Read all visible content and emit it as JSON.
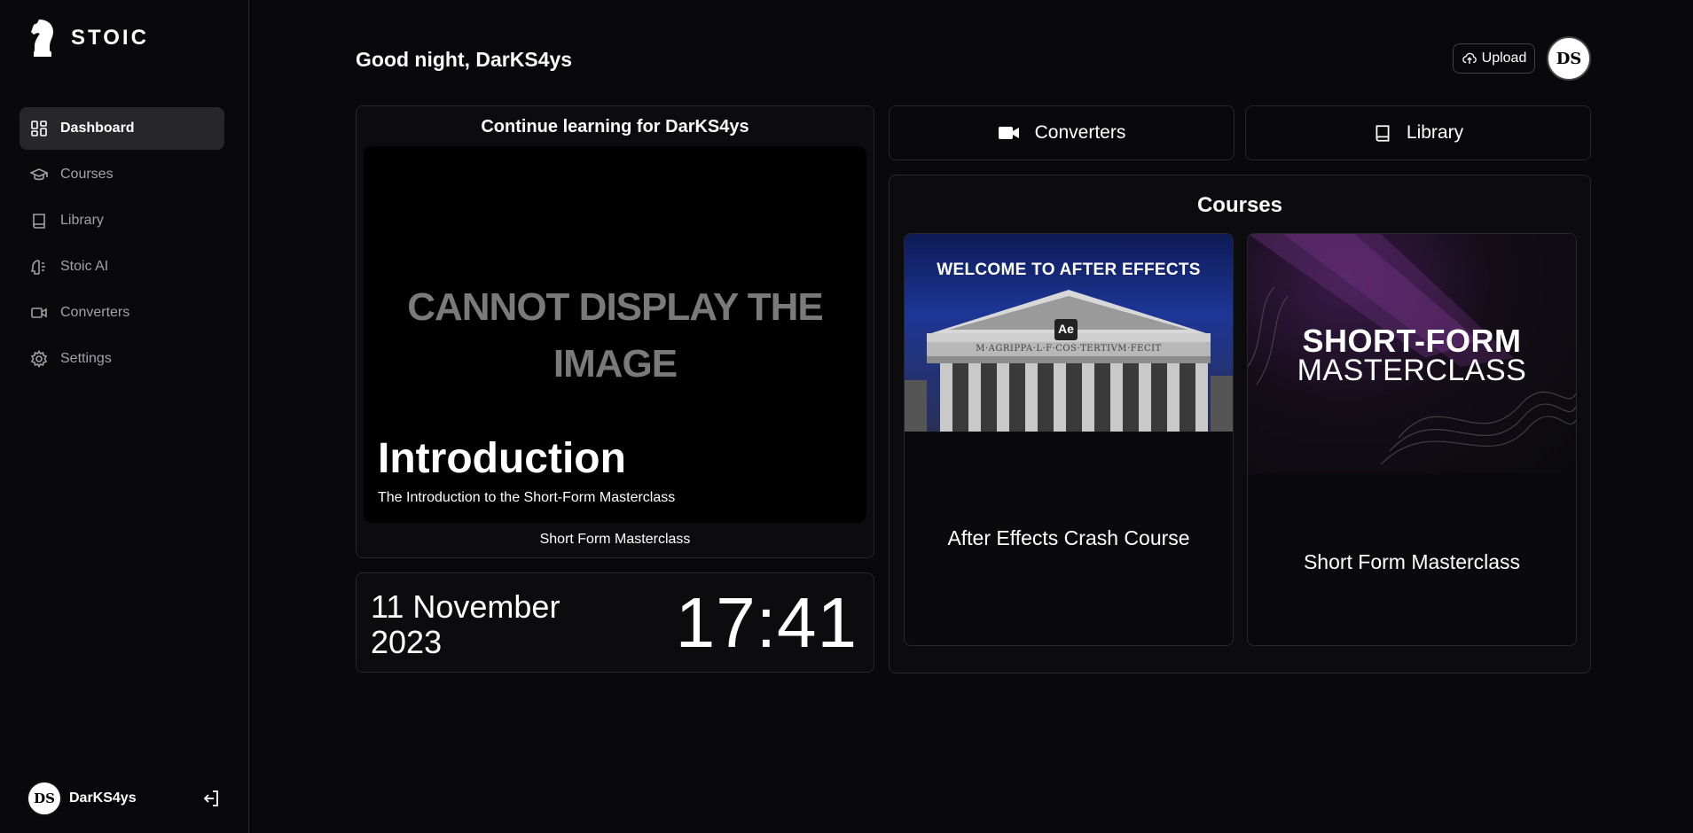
{
  "brand": {
    "name": "STOIC"
  },
  "nav": [
    {
      "label": "Dashboard",
      "icon": "dashboard-icon",
      "active": true
    },
    {
      "label": "Courses",
      "icon": "graduation-cap-icon",
      "active": false
    },
    {
      "label": "Library",
      "icon": "book-icon",
      "active": false
    },
    {
      "label": "Stoic AI",
      "icon": "brain-icon",
      "active": false
    },
    {
      "label": "Converters",
      "icon": "video-icon",
      "active": false
    },
    {
      "label": "Settings",
      "icon": "gear-icon",
      "active": false
    }
  ],
  "user": {
    "name": "DarKS4ys",
    "initials": "DS"
  },
  "header": {
    "greeting": "Good night, DarKS4ys",
    "upload_label": "Upload"
  },
  "continue": {
    "title": "Continue learning for DarKS4ys",
    "placeholder_line1": "CANNOT DISPLAY THE",
    "placeholder_line2": "IMAGE",
    "lesson_title": "Introduction",
    "lesson_subtitle": "The Introduction to the Short-Form Masterclass",
    "course_name": "Short Form Masterclass"
  },
  "clock": {
    "date_line1": "11 November",
    "date_line2": "2023",
    "time": "17:41"
  },
  "quick_links": {
    "converters": "Converters",
    "library": "Library"
  },
  "courses": {
    "title": "Courses",
    "items": [
      {
        "name": "After Effects Crash Course",
        "thumb_title": "WELCOME TO AFTER EFFECTS",
        "thumb_badge": "Ae",
        "thumb_inscription": "M·AGRIPPA·L·F·COS·TERTIVM·FECIT"
      },
      {
        "name": "Short Form Masterclass",
        "thumb_line1": "SHORT-FORM",
        "thumb_line2": "MASTERCLASS"
      }
    ]
  },
  "colors": {
    "background": "#09090b",
    "border": "#27272a",
    "active_nav": "#27272a",
    "muted_text": "#a1a1aa"
  }
}
